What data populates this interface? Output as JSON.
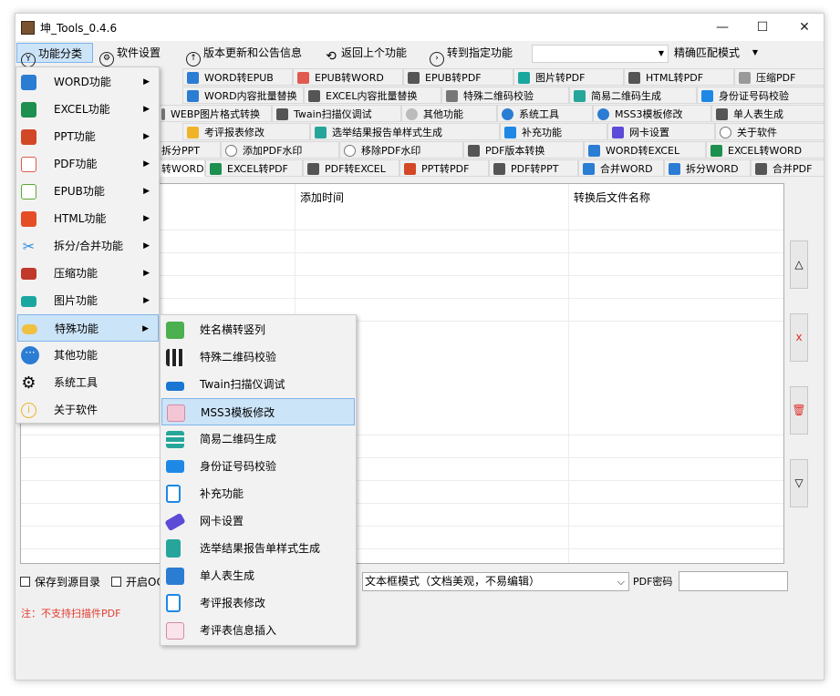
{
  "window": {
    "title": "坤_Tools_0.4.6",
    "controls": [
      "—",
      "☐",
      "✕"
    ]
  },
  "menubar": {
    "items": [
      "功能分类",
      "软件设置",
      "版本更新和公告信息",
      "返回上个功能",
      "转到指定功能"
    ],
    "search_value": "",
    "match_mode": "精确匹配模式"
  },
  "tabs": {
    "row1": [
      "WORD转EPUB",
      "EPUB转WORD",
      "EPUB转PDF",
      "图片转PDF",
      "HTML转PDF",
      "压缩PDF"
    ],
    "row2": [
      "WORD内容批量替换",
      "EXCEL内容批量替换",
      "特殊二维码校验",
      "简易二维码生成",
      "身份证号码校验"
    ],
    "row3": [
      "WEBP图片格式转换",
      "Twain扫描仪调试",
      "其他功能",
      "系统工具",
      "MSS3模板修改",
      "单人表生成"
    ],
    "row4": [
      "考评报表修改",
      "选举结果报告单样式生成",
      "补充功能",
      "网卡设置",
      "关于软件"
    ],
    "row5": [
      "拆分PPT",
      "添加PDF水印",
      "移除PDF水印",
      "PDF版本转换",
      "WORD转EXCEL",
      "EXCEL转WORD"
    ],
    "row6": [
      "转WORD",
      "EXCEL转PDF",
      "PDF转EXCEL",
      "PPT转PDF",
      "PDF转PPT",
      "合并WORD",
      "拆分WORD",
      "合并PDF"
    ]
  },
  "table": {
    "columns": [
      "添加时间",
      "转换后文件名称"
    ]
  },
  "side_buttons": [
    "△",
    "x",
    "🗑",
    "▽"
  ],
  "options": {
    "save_to_source": "保存到源目录",
    "ocr_prefix": "开启OC",
    "text_mode": "文本框模式（文档美观，不易编辑）",
    "pdf_password_label": "PDF密码",
    "pdf_password_value": ""
  },
  "note": "注：不支持扫描件PDF",
  "function_menu": [
    {
      "label": "WORD功能",
      "icon": "word-icon",
      "color": "#2b7cd3"
    },
    {
      "label": "EXCEL功能",
      "icon": "excel-icon",
      "color": "#1d8f4e"
    },
    {
      "label": "PPT功能",
      "icon": "ppt-icon",
      "color": "#d24726"
    },
    {
      "label": "PDF功能",
      "icon": "pdf-icon",
      "color": "#e05a4f"
    },
    {
      "label": "EPUB功能",
      "icon": "epub-icon",
      "color": "#5aa832"
    },
    {
      "label": "HTML功能",
      "icon": "html5-icon",
      "color": "#e44d26"
    },
    {
      "label": "拆分/合并功能",
      "icon": "scissors-icon",
      "color": "#2b8de0"
    },
    {
      "label": "压缩功能",
      "icon": "stack-icon",
      "color": "#c0392b"
    },
    {
      "label": "图片功能",
      "icon": "image-icon",
      "color": "#1aa7a0"
    },
    {
      "label": "特殊功能",
      "icon": "cloud-icon",
      "color": "#f0b429"
    },
    {
      "label": "其他功能",
      "icon": "more-icon",
      "color": "#2b7cd3"
    },
    {
      "label": "系统工具",
      "icon": "gear-icon",
      "color": "#222222"
    },
    {
      "label": "关于软件",
      "icon": "info-icon",
      "color": "#f0b429"
    }
  ],
  "special_submenu": [
    {
      "label": "姓名横转竖列",
      "icon": "name-icon",
      "color": "#4caf50"
    },
    {
      "label": "特殊二维码校验",
      "icon": "qrcode-icon",
      "color": "#222222"
    },
    {
      "label": "Twain扫描仪调试",
      "icon": "scanner-icon",
      "color": "#1976d2"
    },
    {
      "label": "MSS3模板修改",
      "icon": "template-icon",
      "color": "#e8a0b8"
    },
    {
      "label": "简易二维码生成",
      "icon": "qr-generate-icon",
      "color": "#26a69a"
    },
    {
      "label": "身份证号码校验",
      "icon": "id-card-icon",
      "color": "#1e88e5"
    },
    {
      "label": "补充功能",
      "icon": "document-icon",
      "color": "#1e88e5"
    },
    {
      "label": "网卡设置",
      "icon": "network-card-icon",
      "color": "#5c4bd6"
    },
    {
      "label": "选举结果报告单样式生成",
      "icon": "clipboard-icon",
      "color": "#26a69a"
    },
    {
      "label": "单人表生成",
      "icon": "word-icon",
      "color": "#2b7cd3"
    },
    {
      "label": "考评报表修改",
      "icon": "document-icon",
      "color": "#1e88e5"
    },
    {
      "label": "考评表信息插入",
      "icon": "form-icon",
      "color": "#e8a0b8"
    }
  ]
}
